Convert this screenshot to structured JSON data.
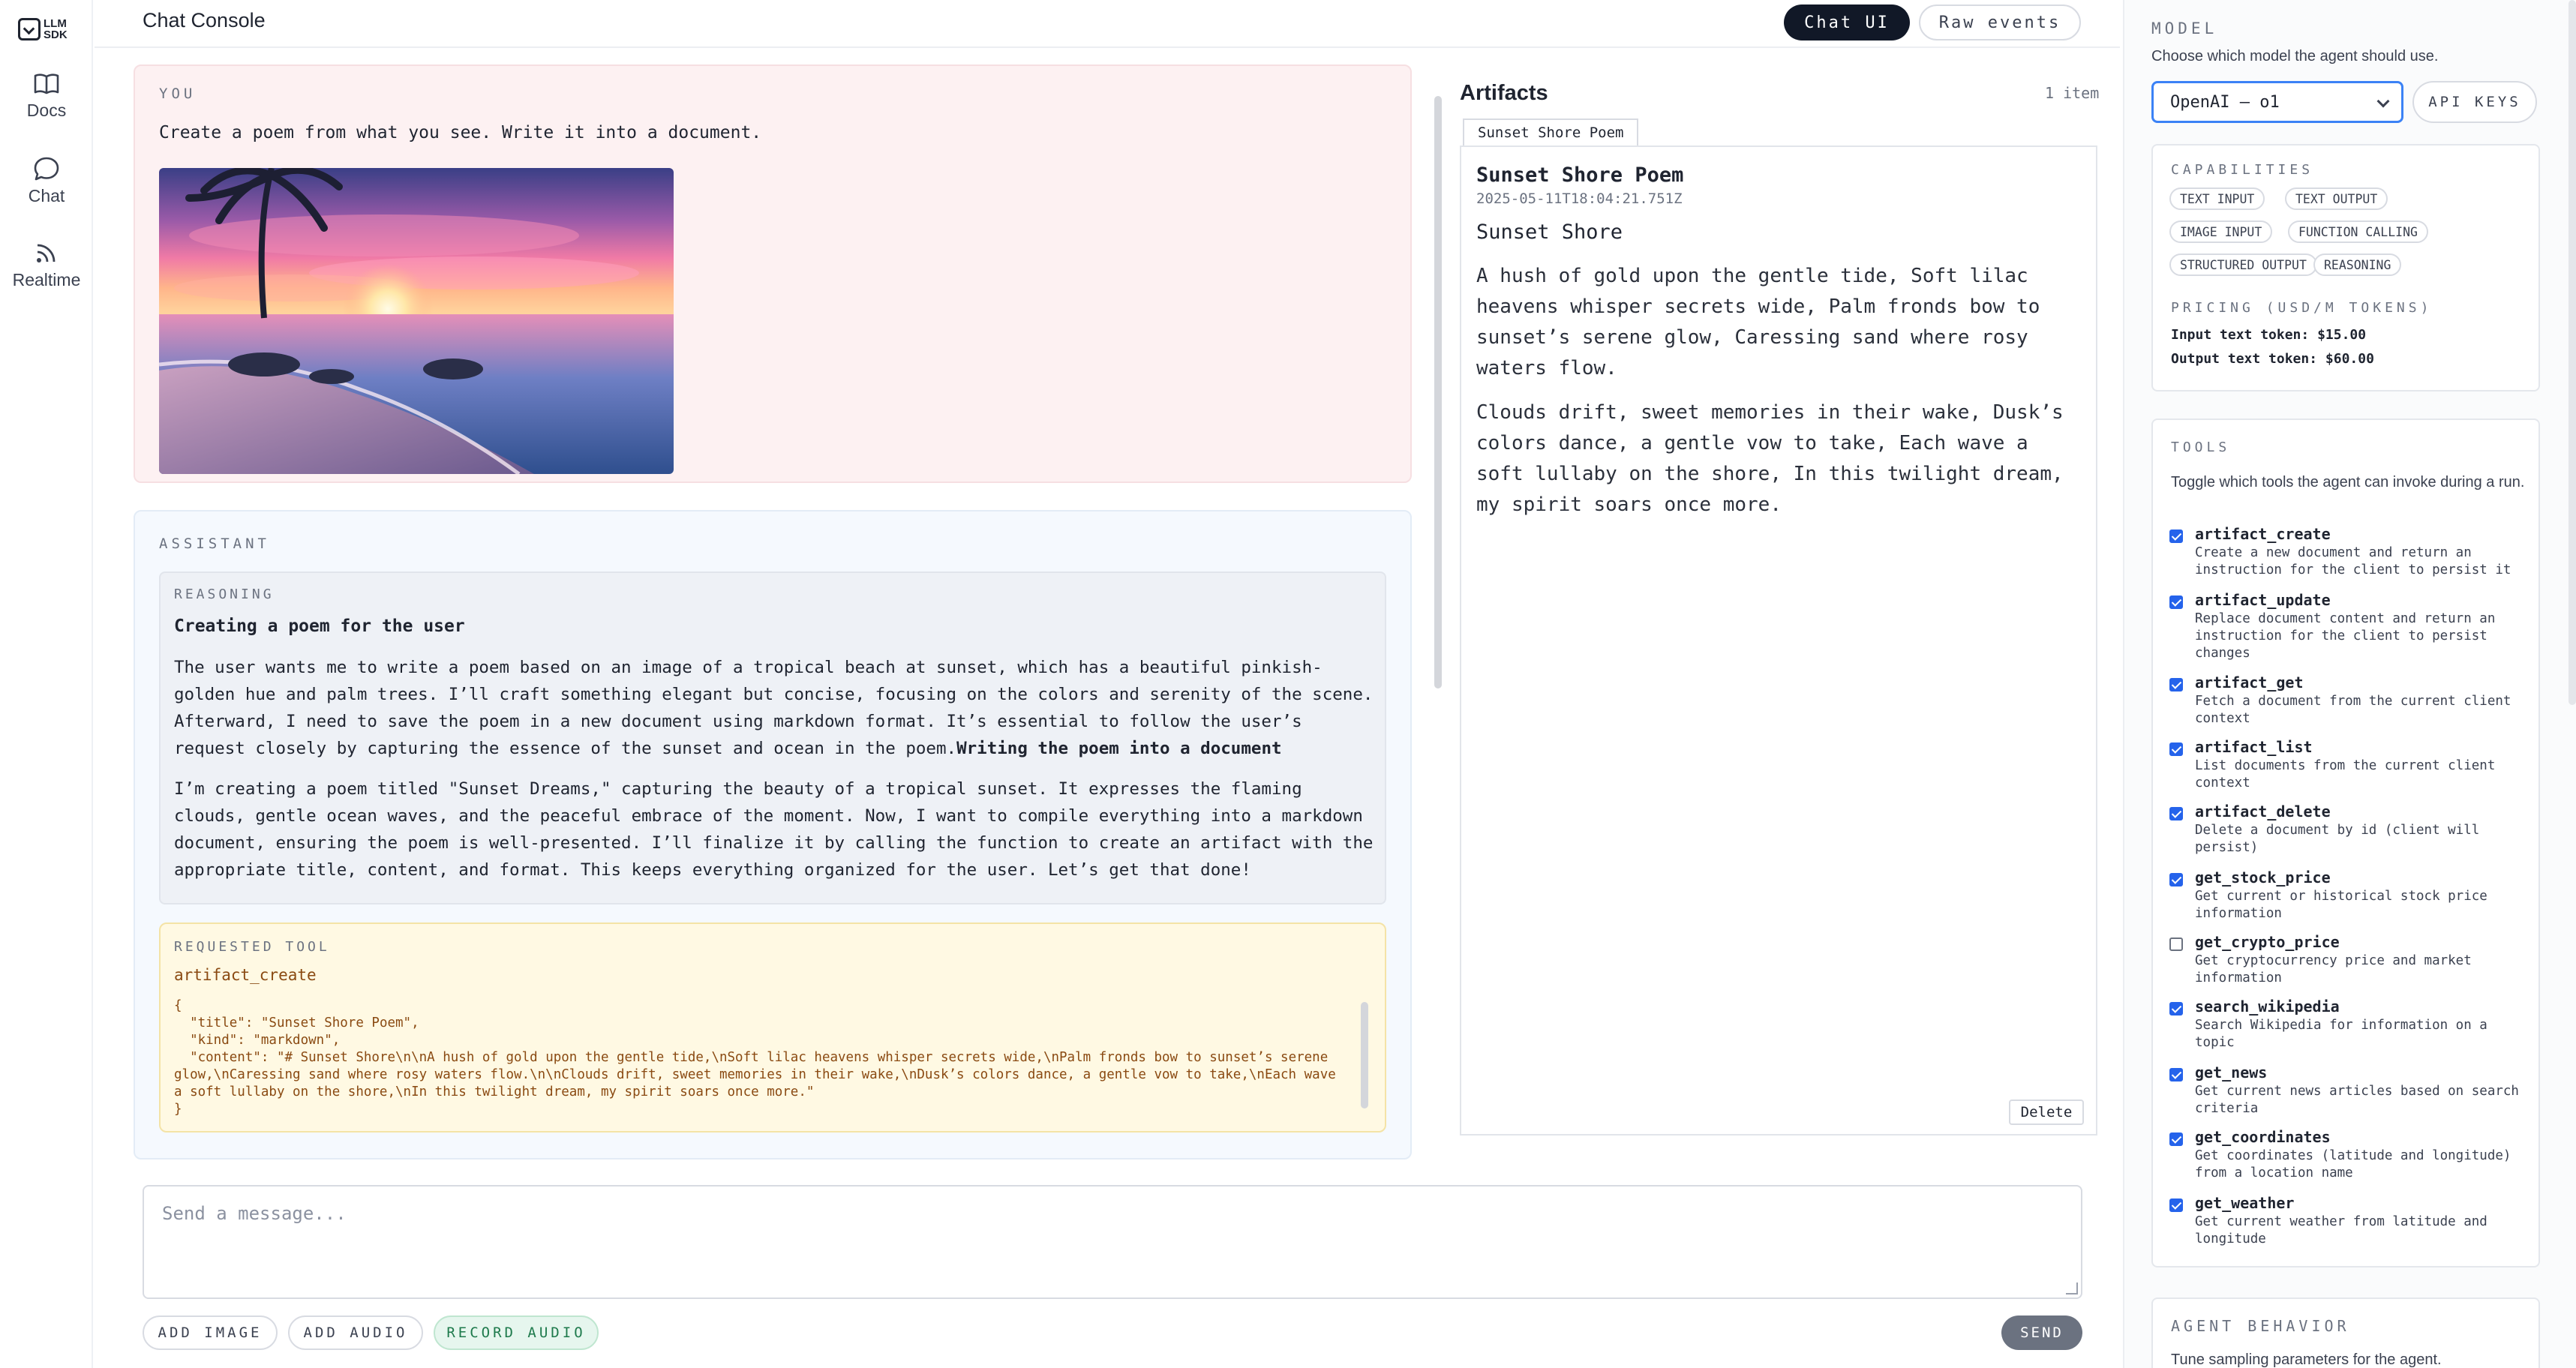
{
  "logo": {
    "line1": "LLM",
    "line2": "SDK"
  },
  "nav": [
    {
      "label": "Docs",
      "icon": "book-icon"
    },
    {
      "label": "Chat",
      "icon": "chat-bubble-icon"
    },
    {
      "label": "Realtime",
      "icon": "broadcast-icon"
    }
  ],
  "header": {
    "title": "Chat Console",
    "tabs": [
      "Chat UI",
      "Raw events"
    ],
    "active_tab": "Chat UI"
  },
  "user_message": {
    "label": "YOU",
    "text": "Create a poem from what you see. Write it into a document."
  },
  "assistant": {
    "label": "ASSISTANT",
    "reasoning": {
      "label": "REASONING",
      "title": "Creating a poem for the user",
      "p1": "The user wants me to write a poem based on an image of a tropical beach at sunset, which has a beautiful pinkish-golden hue and palm trees. I’ll craft something elegant but concise, focusing on the colors and serenity of the scene. Afterward, I need to save the poem in a new document using markdown format. It’s essential to follow the user’s request closely by capturing the essence of the sunset and ocean in the poem.",
      "p1_bold": "Writing the poem into a document",
      "p2": "I’m creating a poem titled \"Sunset Dreams,\" capturing the beauty of a tropical sunset. It expresses the flaming clouds, gentle ocean waves, and the peaceful embrace of the moment. Now, I want to compile everything into a markdown document, ensuring the poem is well-presented. I’ll finalize it by calling the function to create an artifact with the appropriate title, content, and format. This keeps everything organized for the user. Let’s get that done!"
    },
    "tool_call": {
      "label": "REQUESTED TOOL",
      "name": "artifact_create",
      "args": "{\n  \"title\": \"Sunset Shore Poem\",\n  \"kind\": \"markdown\",\n  \"content\": \"# Sunset Shore\\n\\nA hush of gold upon the gentle tide,\\nSoft lilac heavens whisper secrets wide,\\nPalm fronds bow to sunset’s serene glow,\\nCaressing sand where rosy waters flow.\\n\\nClouds drift, sweet memories in their wake,\\nDusk’s colors dance, a gentle vow to take,\\nEach wave a soft lullaby on the shore,\\nIn this twilight dream, my spirit soars once more.\"\n}"
    }
  },
  "composer": {
    "placeholder": "Send a message...",
    "buttons": [
      "ADD IMAGE",
      "ADD AUDIO",
      "RECORD AUDIO"
    ],
    "send_label": "SEND"
  },
  "artifacts": {
    "title": "Artifacts",
    "count": "1 item",
    "tab": "Sunset Shore Poem",
    "doc": {
      "title": "Sunset Shore Poem",
      "date": "2025-05-11T18:04:21.751Z",
      "heading": "Sunset Shore",
      "stanza1": "A hush of gold upon the gentle tide, Soft lilac heavens whisper secrets wide, Palm fronds bow to sunset’s serene glow, Caressing sand where rosy waters flow.",
      "stanza2": "Clouds drift, sweet memories in their wake, Dusk’s colors dance, a gentle vow to take, Each wave a soft lullaby on the shore, In this twilight dream, my spirit soars once more."
    },
    "delete_label": "Delete"
  },
  "settings": {
    "model": {
      "label": "MODEL",
      "desc": "Choose which model the agent should use.",
      "selected": "OpenAI — o1",
      "api_keys_label": "API KEYS"
    },
    "capabilities": {
      "label": "CAPABILITIES",
      "chips": [
        "TEXT INPUT",
        "TEXT OUTPUT",
        "IMAGE INPUT",
        "FUNCTION CALLING",
        "STRUCTURED OUTPUT",
        "REASONING"
      ],
      "pricing_label": "PRICING (USD/M TOKENS)",
      "input_price": "Input text token: $15.00",
      "output_price": "Output text token: $60.00"
    },
    "tools": {
      "label": "TOOLS",
      "desc": "Toggle which tools the agent can invoke during a run.",
      "items": [
        {
          "name": "artifact_create",
          "desc": "Create a new document and return an instruction for the client to persist it",
          "checked": true
        },
        {
          "name": "artifact_update",
          "desc": "Replace document content and return an instruction for the client to persist changes",
          "checked": true
        },
        {
          "name": "artifact_get",
          "desc": "Fetch a document from the current client context",
          "checked": true
        },
        {
          "name": "artifact_list",
          "desc": "List documents from the current client context",
          "checked": true
        },
        {
          "name": "artifact_delete",
          "desc": "Delete a document by id (client will persist)",
          "checked": true
        },
        {
          "name": "get_stock_price",
          "desc": "Get current or historical stock price information",
          "checked": true
        },
        {
          "name": "get_crypto_price",
          "desc": "Get cryptocurrency price and market information",
          "checked": false
        },
        {
          "name": "search_wikipedia",
          "desc": "Search Wikipedia for information on a topic",
          "checked": true
        },
        {
          "name": "get_news",
          "desc": "Get current news articles based on search criteria",
          "checked": true
        },
        {
          "name": "get_coordinates",
          "desc": "Get coordinates (latitude and longitude) from a location name",
          "checked": true
        },
        {
          "name": "get_weather",
          "desc": "Get current weather from latitude and longitude",
          "checked": true
        }
      ]
    },
    "agent_behavior": {
      "label": "AGENT BEHAVIOR",
      "desc": "Tune sampling parameters for the agent."
    }
  }
}
